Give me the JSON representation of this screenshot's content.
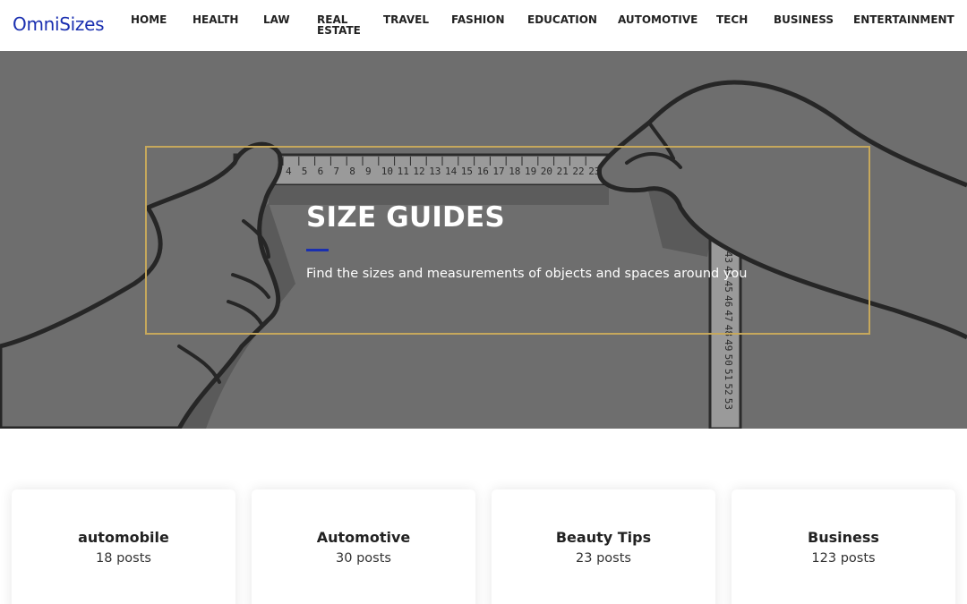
{
  "brand": {
    "name": "OmniSizes",
    "color": "#1a2fb0"
  },
  "nav": [
    {
      "label": "HOME"
    },
    {
      "label": "HEALTH"
    },
    {
      "label": "LAW"
    },
    {
      "label": "REAL ESTATE"
    },
    {
      "label": "TRAVEL"
    },
    {
      "label": "FASHION"
    },
    {
      "label": "EDUCATION"
    },
    {
      "label": "AUTOMOTIVE"
    },
    {
      "label": "TECH"
    },
    {
      "label": "BUSINESS"
    },
    {
      "label": "ENTERTAINMENT"
    }
  ],
  "hero": {
    "title": "SIZE GUIDES",
    "subtitle": "Find the sizes and measurements of objects and spaces around you",
    "accent_color": "#1a2fb0",
    "frame_color": "#c6a85c",
    "ruler_top_numbers": [
      "4",
      "5",
      "6",
      "7",
      "8",
      "9",
      "10",
      "11",
      "12",
      "13",
      "14",
      "15",
      "16",
      "17",
      "18",
      "19",
      "20",
      "21",
      "22",
      "23"
    ],
    "ruler_side_numbers": [
      "42",
      "43",
      "44",
      "45",
      "46",
      "47",
      "48",
      "49",
      "50",
      "51",
      "52",
      "53"
    ]
  },
  "categories": [
    {
      "name": "automobile",
      "count": "18 posts"
    },
    {
      "name": "Automotive",
      "count": "30 posts"
    },
    {
      "name": "Beauty Tips",
      "count": "23 posts"
    },
    {
      "name": "Business",
      "count": "123 posts"
    }
  ]
}
